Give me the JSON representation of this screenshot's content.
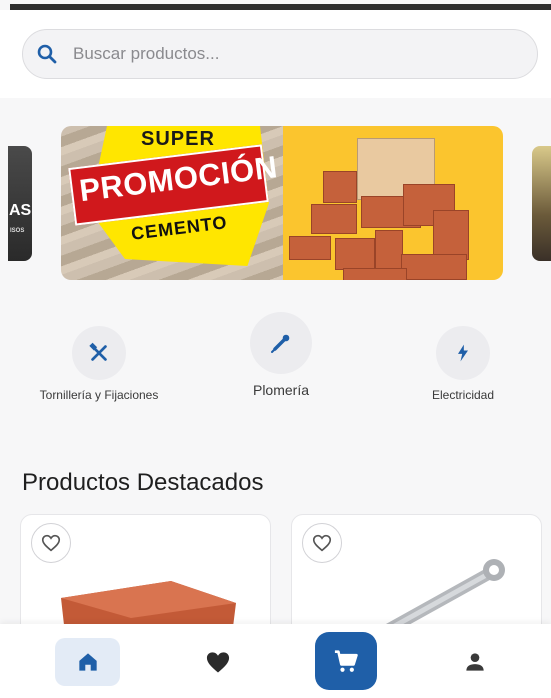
{
  "search": {
    "placeholder": "Buscar productos..."
  },
  "banner": {
    "prev_slide_text": "AS",
    "prev_slide_subtext": "ISOS",
    "promo_line1": "SUPER",
    "promo_line2": "PROMOCIÓN",
    "promo_line3": "CEMENTO"
  },
  "categories": [
    {
      "label": "Tornillería y Fijaciones",
      "icon": "tools-icon"
    },
    {
      "label": "Plomería",
      "icon": "pipe-icon"
    },
    {
      "label": "Electricidad",
      "icon": "bolt-icon"
    }
  ],
  "featured": {
    "title": "Productos Destacados"
  },
  "bottom_nav": [
    {
      "name": "home",
      "icon": "home-icon",
      "active": true
    },
    {
      "name": "favorites",
      "icon": "heart-icon",
      "active": false
    },
    {
      "name": "cart",
      "icon": "cart-icon",
      "active": false
    },
    {
      "name": "profile",
      "icon": "person-icon",
      "active": false
    }
  ],
  "colors": {
    "primary": "#1f5fa8",
    "active_bg": "#e3ebf6",
    "icon_dark": "#2b2b2b",
    "promo_red": "#d0181c",
    "promo_yellow": "#ffe600",
    "banner_yellow": "#fbc52e"
  }
}
